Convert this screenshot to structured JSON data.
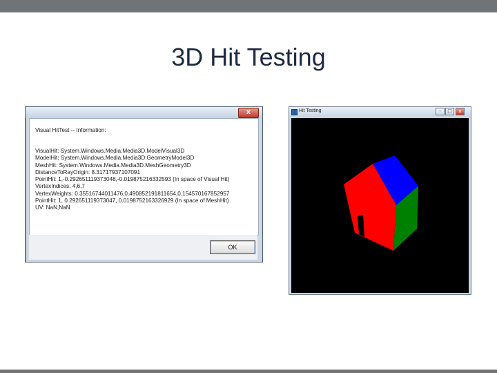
{
  "slide": {
    "title": "3D Hit Testing"
  },
  "dialog": {
    "title": "",
    "close_label": "x",
    "header": "Visual HitTest -- Information:",
    "lines": [
      "VisualHit: System.Windows.Media.Media3D.ModelVisual3D",
      "ModelHit: System.Windows.Media.Media3D.GeometryModel3D",
      "MeshHit: System.Windows.Media.Media3D.MeshGeometry3D",
      "DistanceToRayOrigin: 8.31717937107091",
      "PointHit: 1,-0.292651119373048,-0.019875216332593 (In space of Visual Hit)",
      "VertexIndices: 4,6,7",
      "VertexWeights: 0.35516744011476,0.490852191811654,0.154570167852957",
      "PointHit: 1, 0.292651119373047, 0.0198752163326929 (In space of MeshHit)",
      "UV: NaN,NaN"
    ],
    "ok_label": "OK"
  },
  "viewport_window": {
    "title": "Hit Testing",
    "min_label": "-",
    "max_label": "□",
    "close_label": "x",
    "colors": {
      "background": "#000000",
      "roof": "#0000ff",
      "front": "#ff0000",
      "side": "#008000"
    }
  }
}
